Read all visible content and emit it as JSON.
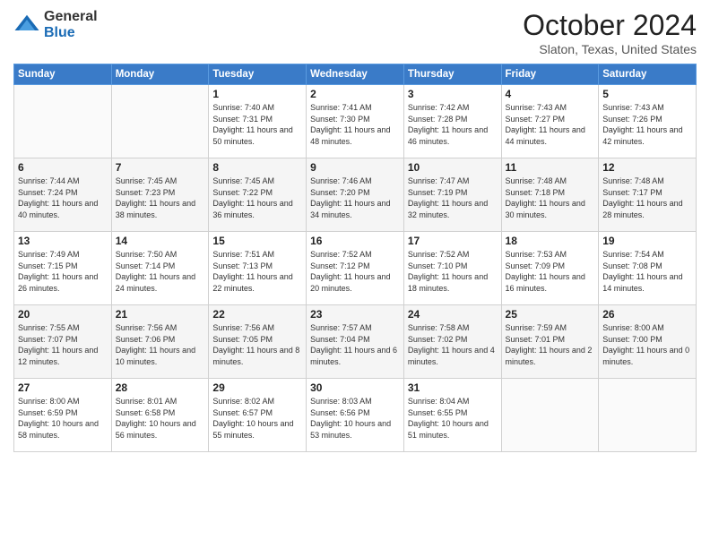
{
  "header": {
    "logo_general": "General",
    "logo_blue": "Blue",
    "month_title": "October 2024",
    "location": "Slaton, Texas, United States"
  },
  "days_of_week": [
    "Sunday",
    "Monday",
    "Tuesday",
    "Wednesday",
    "Thursday",
    "Friday",
    "Saturday"
  ],
  "weeks": [
    [
      {
        "day": "",
        "info": ""
      },
      {
        "day": "",
        "info": ""
      },
      {
        "day": "1",
        "info": "Sunrise: 7:40 AM\nSunset: 7:31 PM\nDaylight: 11 hours and 50 minutes."
      },
      {
        "day": "2",
        "info": "Sunrise: 7:41 AM\nSunset: 7:30 PM\nDaylight: 11 hours and 48 minutes."
      },
      {
        "day": "3",
        "info": "Sunrise: 7:42 AM\nSunset: 7:28 PM\nDaylight: 11 hours and 46 minutes."
      },
      {
        "day": "4",
        "info": "Sunrise: 7:43 AM\nSunset: 7:27 PM\nDaylight: 11 hours and 44 minutes."
      },
      {
        "day": "5",
        "info": "Sunrise: 7:43 AM\nSunset: 7:26 PM\nDaylight: 11 hours and 42 minutes."
      }
    ],
    [
      {
        "day": "6",
        "info": "Sunrise: 7:44 AM\nSunset: 7:24 PM\nDaylight: 11 hours and 40 minutes."
      },
      {
        "day": "7",
        "info": "Sunrise: 7:45 AM\nSunset: 7:23 PM\nDaylight: 11 hours and 38 minutes."
      },
      {
        "day": "8",
        "info": "Sunrise: 7:45 AM\nSunset: 7:22 PM\nDaylight: 11 hours and 36 minutes."
      },
      {
        "day": "9",
        "info": "Sunrise: 7:46 AM\nSunset: 7:20 PM\nDaylight: 11 hours and 34 minutes."
      },
      {
        "day": "10",
        "info": "Sunrise: 7:47 AM\nSunset: 7:19 PM\nDaylight: 11 hours and 32 minutes."
      },
      {
        "day": "11",
        "info": "Sunrise: 7:48 AM\nSunset: 7:18 PM\nDaylight: 11 hours and 30 minutes."
      },
      {
        "day": "12",
        "info": "Sunrise: 7:48 AM\nSunset: 7:17 PM\nDaylight: 11 hours and 28 minutes."
      }
    ],
    [
      {
        "day": "13",
        "info": "Sunrise: 7:49 AM\nSunset: 7:15 PM\nDaylight: 11 hours and 26 minutes."
      },
      {
        "day": "14",
        "info": "Sunrise: 7:50 AM\nSunset: 7:14 PM\nDaylight: 11 hours and 24 minutes."
      },
      {
        "day": "15",
        "info": "Sunrise: 7:51 AM\nSunset: 7:13 PM\nDaylight: 11 hours and 22 minutes."
      },
      {
        "day": "16",
        "info": "Sunrise: 7:52 AM\nSunset: 7:12 PM\nDaylight: 11 hours and 20 minutes."
      },
      {
        "day": "17",
        "info": "Sunrise: 7:52 AM\nSunset: 7:10 PM\nDaylight: 11 hours and 18 minutes."
      },
      {
        "day": "18",
        "info": "Sunrise: 7:53 AM\nSunset: 7:09 PM\nDaylight: 11 hours and 16 minutes."
      },
      {
        "day": "19",
        "info": "Sunrise: 7:54 AM\nSunset: 7:08 PM\nDaylight: 11 hours and 14 minutes."
      }
    ],
    [
      {
        "day": "20",
        "info": "Sunrise: 7:55 AM\nSunset: 7:07 PM\nDaylight: 11 hours and 12 minutes."
      },
      {
        "day": "21",
        "info": "Sunrise: 7:56 AM\nSunset: 7:06 PM\nDaylight: 11 hours and 10 minutes."
      },
      {
        "day": "22",
        "info": "Sunrise: 7:56 AM\nSunset: 7:05 PM\nDaylight: 11 hours and 8 minutes."
      },
      {
        "day": "23",
        "info": "Sunrise: 7:57 AM\nSunset: 7:04 PM\nDaylight: 11 hours and 6 minutes."
      },
      {
        "day": "24",
        "info": "Sunrise: 7:58 AM\nSunset: 7:02 PM\nDaylight: 11 hours and 4 minutes."
      },
      {
        "day": "25",
        "info": "Sunrise: 7:59 AM\nSunset: 7:01 PM\nDaylight: 11 hours and 2 minutes."
      },
      {
        "day": "26",
        "info": "Sunrise: 8:00 AM\nSunset: 7:00 PM\nDaylight: 11 hours and 0 minutes."
      }
    ],
    [
      {
        "day": "27",
        "info": "Sunrise: 8:00 AM\nSunset: 6:59 PM\nDaylight: 10 hours and 58 minutes."
      },
      {
        "day": "28",
        "info": "Sunrise: 8:01 AM\nSunset: 6:58 PM\nDaylight: 10 hours and 56 minutes."
      },
      {
        "day": "29",
        "info": "Sunrise: 8:02 AM\nSunset: 6:57 PM\nDaylight: 10 hours and 55 minutes."
      },
      {
        "day": "30",
        "info": "Sunrise: 8:03 AM\nSunset: 6:56 PM\nDaylight: 10 hours and 53 minutes."
      },
      {
        "day": "31",
        "info": "Sunrise: 8:04 AM\nSunset: 6:55 PM\nDaylight: 10 hours and 51 minutes."
      },
      {
        "day": "",
        "info": ""
      },
      {
        "day": "",
        "info": ""
      }
    ]
  ]
}
